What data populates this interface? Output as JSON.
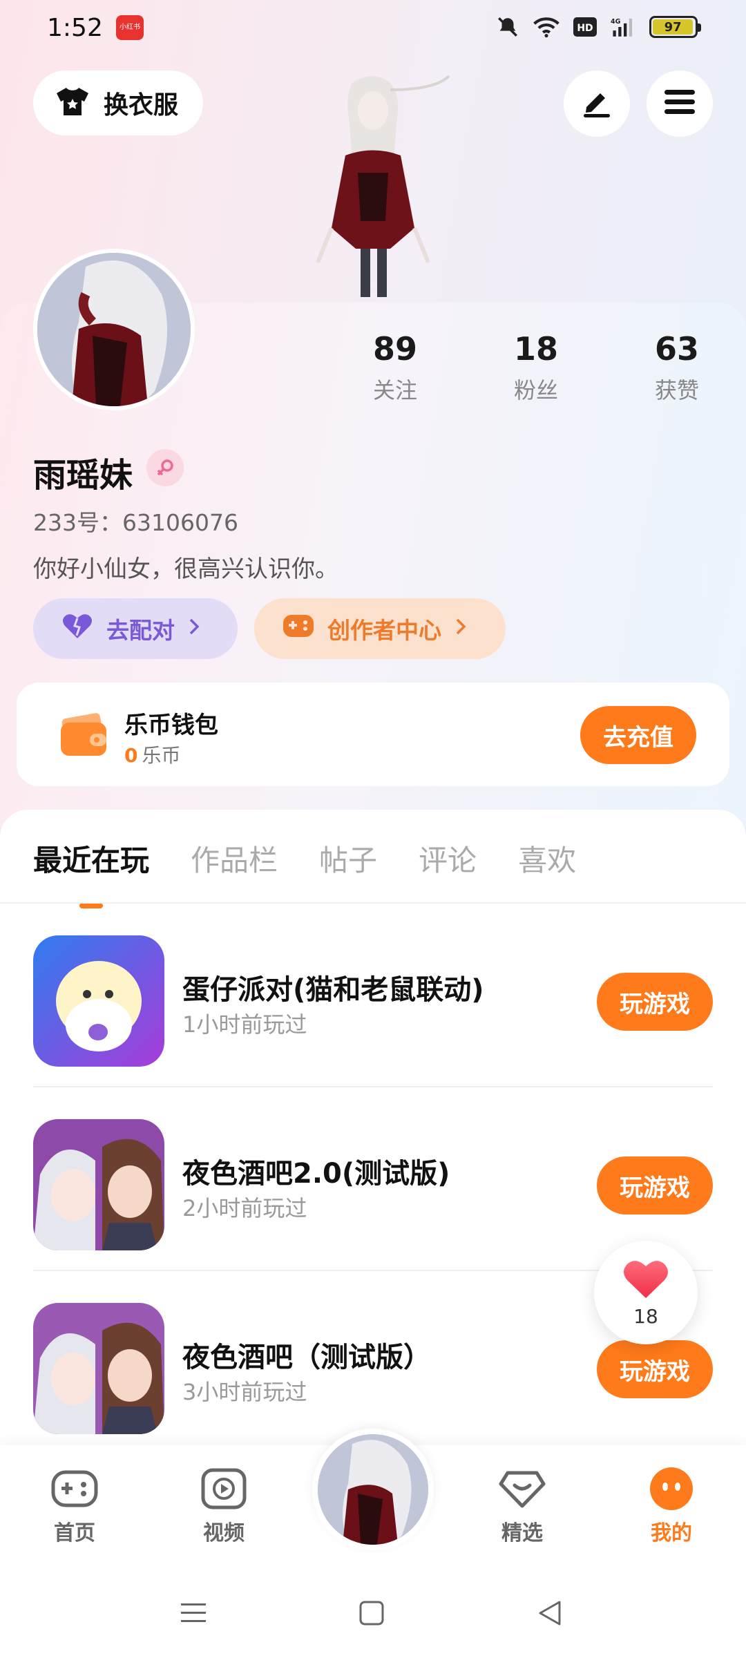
{
  "status_bar": {
    "time": "1:52",
    "app_badge": "小红书",
    "network": "4G",
    "hd": "HD",
    "battery": "97",
    "battery_level": 0.97
  },
  "header": {
    "outfit_label": "换衣服",
    "edit_icon": "pen-icon",
    "menu_icon": "hamburger-icon"
  },
  "profile": {
    "nickname": "雨瑶妹",
    "user_id": "233号：63106076",
    "bio": "你好小仙女，很高兴认识你。",
    "stats": [
      {
        "value": "89",
        "label": "关注"
      },
      {
        "value": "18",
        "label": "粉丝"
      },
      {
        "value": "63",
        "label": "获赞"
      }
    ],
    "match_label": "去配对",
    "creator_label": "创作者中心"
  },
  "wallet": {
    "title": "乐币钱包",
    "amount": "0",
    "unit": "乐币",
    "recharge_label": "去充值"
  },
  "tabs": [
    {
      "label": "最近在玩",
      "active": true
    },
    {
      "label": "作品栏",
      "active": false
    },
    {
      "label": "帖子",
      "active": false
    },
    {
      "label": "评论",
      "active": false
    },
    {
      "label": "喜欢",
      "active": false
    }
  ],
  "games": [
    {
      "name": "蛋仔派对(猫和老鼠联动)",
      "time": "1小时前玩过",
      "action": "玩游戏"
    },
    {
      "name": "夜色酒吧2.0(测试版)",
      "time": "2小时前玩过",
      "action": "玩游戏"
    },
    {
      "name": "夜色酒吧（测试版）",
      "time": "3小时前玩过",
      "action": "玩游戏"
    }
  ],
  "like_float": {
    "count": "18"
  },
  "bottom_nav": [
    {
      "label": "首页",
      "icon": "gamepad-icon",
      "active": false
    },
    {
      "label": "视频",
      "icon": "play-icon",
      "active": false
    },
    {
      "label": "精选",
      "icon": "heart-box-icon",
      "active": false
    },
    {
      "label": "我的",
      "icon": "face-icon",
      "active": true
    }
  ],
  "colors": {
    "accent": "#ff7a1a",
    "match": "#7a59d9",
    "match_bg": "#e3dcf6",
    "creator_bg": "#fde1cf"
  }
}
